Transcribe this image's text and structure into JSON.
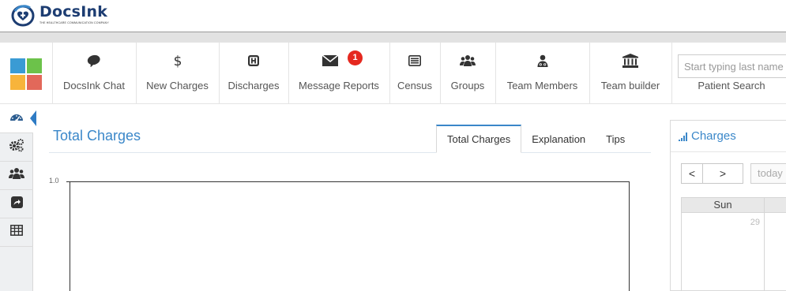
{
  "app": {
    "name": "DocsInk",
    "tagline": "THE HEALTHCARE COMMUNICATION COMPANY"
  },
  "colors": {
    "accent": "#3a87c9",
    "brand_navy": "#1d3d72",
    "badge_red": "#e5281f",
    "tile_colors": [
      "#3a9bd4",
      "#6cc24a",
      "#f7b43b",
      "#e2685a"
    ]
  },
  "nav": {
    "items": [
      {
        "label": "DocsInk Chat",
        "icon": "chat-icon"
      },
      {
        "label": "New Charges",
        "icon": "dollar-icon"
      },
      {
        "label": "Discharges",
        "icon": "hospital-h-icon"
      },
      {
        "label": "Message Reports",
        "icon": "envelope-icon",
        "badge": "1"
      },
      {
        "label": "Census",
        "icon": "list-icon"
      },
      {
        "label": "Groups",
        "icon": "users-icon"
      },
      {
        "label": "Team Members",
        "icon": "doctor-icon"
      },
      {
        "label": "Team builder",
        "icon": "building-icon"
      }
    ],
    "search": {
      "placeholder": "Start typing last name",
      "label": "Patient Search"
    }
  },
  "sidebar": {
    "items": [
      {
        "icon": "dashboard-icon",
        "active": true
      },
      {
        "icon": "cogs-icon"
      },
      {
        "icon": "users-icon"
      },
      {
        "icon": "share-icon"
      },
      {
        "icon": "table-icon"
      }
    ]
  },
  "main": {
    "title": "Total Charges",
    "tabs": [
      {
        "label": "Total Charges",
        "active": true
      },
      {
        "label": "Explanation"
      },
      {
        "label": "Tips"
      }
    ],
    "chart": {
      "y_tick": "1.0"
    }
  },
  "charges_panel": {
    "title": "Charges",
    "prev_label": "<",
    "next_label": ">",
    "today_label": "today",
    "weekday_header": "Sun",
    "first_day": "29"
  }
}
